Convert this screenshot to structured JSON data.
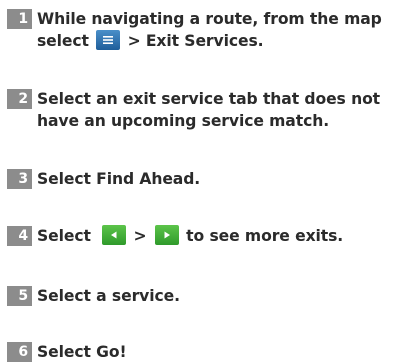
{
  "steps": [
    {
      "number": "1",
      "line1": "While navigating a route, from the map",
      "line2_prefix": "select",
      "line2_icon": "menu-icon",
      "line2_suffix": "> Exit Services."
    },
    {
      "number": "2",
      "line1": "Select an exit service tab that does not",
      "line2": "have an upcoming service match."
    },
    {
      "number": "3",
      "line1": "Select Find Ahead."
    },
    {
      "number": "4",
      "prefix": "Select",
      "icon_left": "left-arrow-icon",
      "separator": ">",
      "icon_right": "right-arrow-icon",
      "suffix": "to see more exits."
    },
    {
      "number": "5",
      "line1": "Select a service."
    },
    {
      "number": "6",
      "line1": "Select Go!"
    }
  ],
  "colors": {
    "number_badge": "#8c8c8c",
    "text": "#2b2b2b",
    "menu_icon": "#2f72b3",
    "arrow_icon": "#3fae36"
  }
}
